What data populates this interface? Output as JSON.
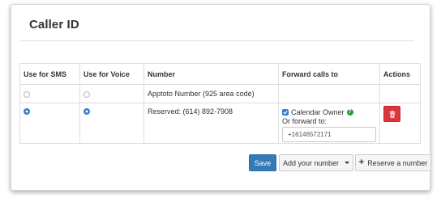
{
  "panel": {
    "title": "Caller ID"
  },
  "table": {
    "headers": [
      "Use for SMS",
      "Use for Voice",
      "Number",
      "Forward calls to",
      "Actions"
    ],
    "rows": [
      {
        "sms_selected": false,
        "voice_selected": false,
        "number": "Apptoto Number (925 area code)"
      },
      {
        "sms_selected": true,
        "voice_selected": true,
        "number": "Reserved: (614) 892-7908",
        "forward_checkbox_label": "Calendar Owner",
        "forward_checked": true,
        "or_forward_label": "Or forward to:",
        "forward_value": "+16146572171"
      }
    ]
  },
  "buttons": {
    "save": "Save",
    "add_number": "Add your number",
    "reserve_number": "Reserve a number"
  },
  "icons": {
    "help": "?",
    "plus": "+",
    "delete": "trash-icon"
  },
  "colors": {
    "primary": "#337ab7",
    "danger": "#d9363e",
    "help_green": "#2e9a35",
    "radio_blue": "#2f80d8"
  }
}
